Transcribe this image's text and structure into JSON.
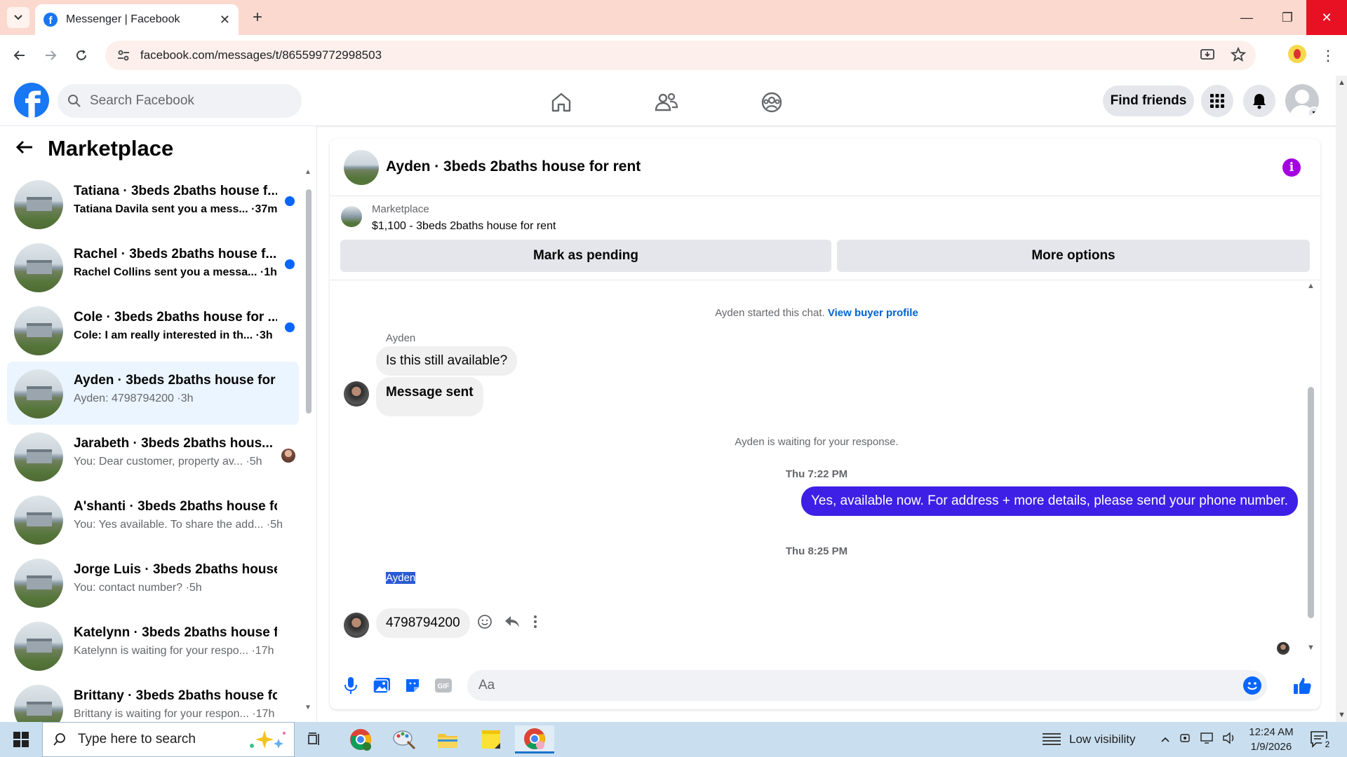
{
  "browser": {
    "tab_title": "Messenger | Facebook",
    "url": "facebook.com/messages/t/865599772998503"
  },
  "fb_header": {
    "search_placeholder": "Search Facebook",
    "find_friends": "Find friends"
  },
  "left_panel": {
    "title": "Marketplace",
    "conversations": [
      {
        "name": "Tatiana · 3beds 2baths house f...",
        "preview": "Tatiana Davila sent you a mess... ·37m",
        "unread": true,
        "status": "dot"
      },
      {
        "name": "Rachel · 3beds 2baths house f...",
        "preview": "Rachel Collins sent you a messa... ·1h",
        "unread": true,
        "status": "dot"
      },
      {
        "name": "Cole · 3beds 2baths house for ...",
        "preview": "Cole: I am really interested in th... ·3h",
        "unread": true,
        "status": "dot"
      },
      {
        "name": "Ayden · 3beds 2baths house for ...",
        "preview": "Ayden: 4798794200 ·3h",
        "unread": false,
        "status": "active"
      },
      {
        "name": "Jarabeth · 3beds 2baths hous...",
        "preview": "You: Dear customer, property av... ·5h",
        "unread": false,
        "status": "seen"
      },
      {
        "name": "A'shanti · 3beds 2baths house fo...",
        "preview": "You: Yes available. To share the add... ·5h",
        "unread": false,
        "status": "none"
      },
      {
        "name": "Jorge Luis · 3beds 2baths house ...",
        "preview": "You: contact number? ·5h",
        "unread": false,
        "status": "none"
      },
      {
        "name": "Katelynn · 3beds 2baths house f...",
        "preview": "Katelynn is waiting for your respo... ·17h",
        "unread": false,
        "status": "none"
      },
      {
        "name": "Brittany · 3beds 2baths house fo...",
        "preview": "Brittany is waiting for your respon... ·17h",
        "unread": false,
        "status": "none"
      }
    ]
  },
  "chat": {
    "title": "Ayden · 3beds 2baths house for rent",
    "listing_category": "Marketplace",
    "listing_desc": "$1,100 - 3beds 2baths house for rent",
    "mark_pending": "Mark as pending",
    "more_options": "More options",
    "started_text": "Ayden started this chat.",
    "view_profile": "View buyer profile",
    "sender_name": "Ayden",
    "msg1": "Is this still available?",
    "msg2": "Message sent",
    "waiting_text": "Ayden is waiting for your response.",
    "time1": "Thu 7:22 PM",
    "my_msg": "Yes, available now. For address + more details, please send your phone number.",
    "time2": "Thu 8:25 PM",
    "sender_name2": "Ayden",
    "msg3": "4798794200",
    "composer_placeholder": "Aa"
  },
  "taskbar": {
    "search_placeholder": "Type here to search",
    "weather": "Low visibility",
    "time": "12:24 AM",
    "date": "1/9/2026",
    "notif_count": "2"
  },
  "colors": {
    "fb_blue": "#1877f2",
    "my_bubble": "#3e1fe6",
    "unread_dot": "#0866ff",
    "info_purple": "#a400e2"
  }
}
